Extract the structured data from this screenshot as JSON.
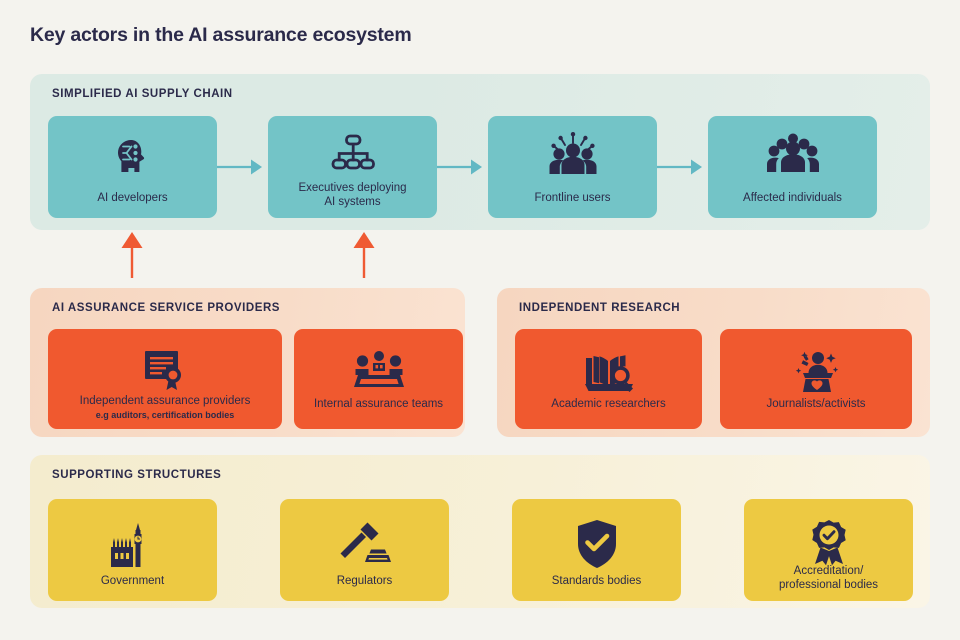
{
  "title": "Key actors in the AI assurance ecosystem",
  "colors": {
    "page_background": "#f4f3ee",
    "supply_panel": "#dceae4",
    "supply_box": "#73c4c7",
    "supply_arrow": "#62b8c4",
    "assurance_panel": "#f7d9c4",
    "assurance_box": "#f0592f",
    "support_panel": "#f5ecce",
    "support_box": "#edc942",
    "ink": "#2b2a4a",
    "vertical_arrow": "#ef5a33"
  },
  "sections": {
    "supply_chain": {
      "title": "SIMPLIFIED AI SUPPLY CHAIN",
      "items": [
        {
          "label": "AI developers",
          "label2": "",
          "icon": "ai-head-circuit-icon"
        },
        {
          "label": "Executives deploying",
          "label2": "AI systems",
          "icon": "org-chart-icon"
        },
        {
          "label": "Frontline users",
          "label2": "",
          "icon": "frontline-users-icon"
        },
        {
          "label": "Affected individuals",
          "label2": "",
          "icon": "people-group-icon"
        }
      ]
    },
    "assurance_providers": {
      "title": "AI ASSURANCE SERVICE PROVIDERS",
      "items": [
        {
          "label": "Independent assurance providers",
          "sublabel": "e.g auditors, certification bodies",
          "icon": "certificate-icon"
        },
        {
          "label": "Internal assurance teams",
          "sublabel": "",
          "icon": "team-table-icon"
        }
      ]
    },
    "independent_research": {
      "title": "INDEPENDENT RESEARCH",
      "items": [
        {
          "label": "Academic researchers",
          "sublabel": "",
          "icon": "book-magnifier-icon"
        },
        {
          "label": "Journalists/activists",
          "sublabel": "",
          "icon": "podium-heart-icon"
        }
      ]
    },
    "supporting_structures": {
      "title": "SUPPORTING STRUCTURES",
      "items": [
        {
          "label": "Government",
          "label2": "",
          "icon": "parliament-icon"
        },
        {
          "label": "Regulators",
          "label2": "",
          "icon": "gavel-icon"
        },
        {
          "label": "Standards bodies",
          "label2": "",
          "icon": "shield-check-icon"
        },
        {
          "label": "Accreditation/",
          "label2": "professional bodies",
          "icon": "award-ribbon-icon"
        }
      ]
    }
  }
}
